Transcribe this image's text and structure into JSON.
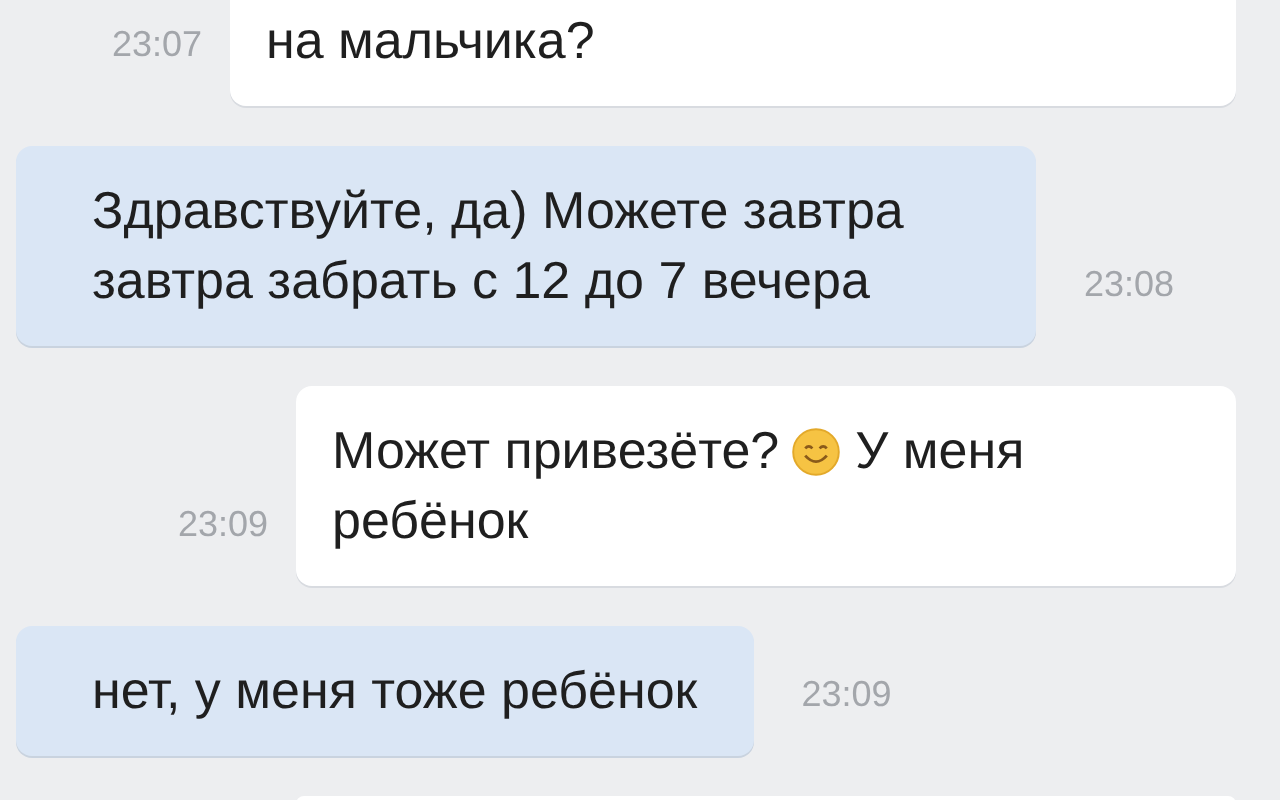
{
  "messages": [
    {
      "kind": "outgoing",
      "lines": [
        [
          {
            "kind": "text",
            "text": "на мальчика?"
          }
        ]
      ],
      "time": "23:07"
    },
    {
      "kind": "incoming",
      "lines": [
        [
          {
            "kind": "text",
            "text": "Здравствуйте, да) Можете завтра завтра забрать с 12 до 7 вечера"
          }
        ]
      ],
      "time": "23:08"
    },
    {
      "kind": "outgoing",
      "lines": [
        [
          {
            "kind": "text",
            "text": "Может привезёте?"
          },
          {
            "kind": "emoji"
          },
          {
            "kind": "text",
            "text": "У меня"
          }
        ],
        [
          {
            "kind": "text",
            "text": "ребёнок"
          }
        ]
      ],
      "time": "23:09"
    },
    {
      "kind": "incoming",
      "lines": [
        [
          {
            "kind": "text",
            "text": "нет, у меня тоже ребёнок"
          }
        ]
      ],
      "time": "23:09"
    },
    {
      "kind": "outgoing"
    }
  ]
}
